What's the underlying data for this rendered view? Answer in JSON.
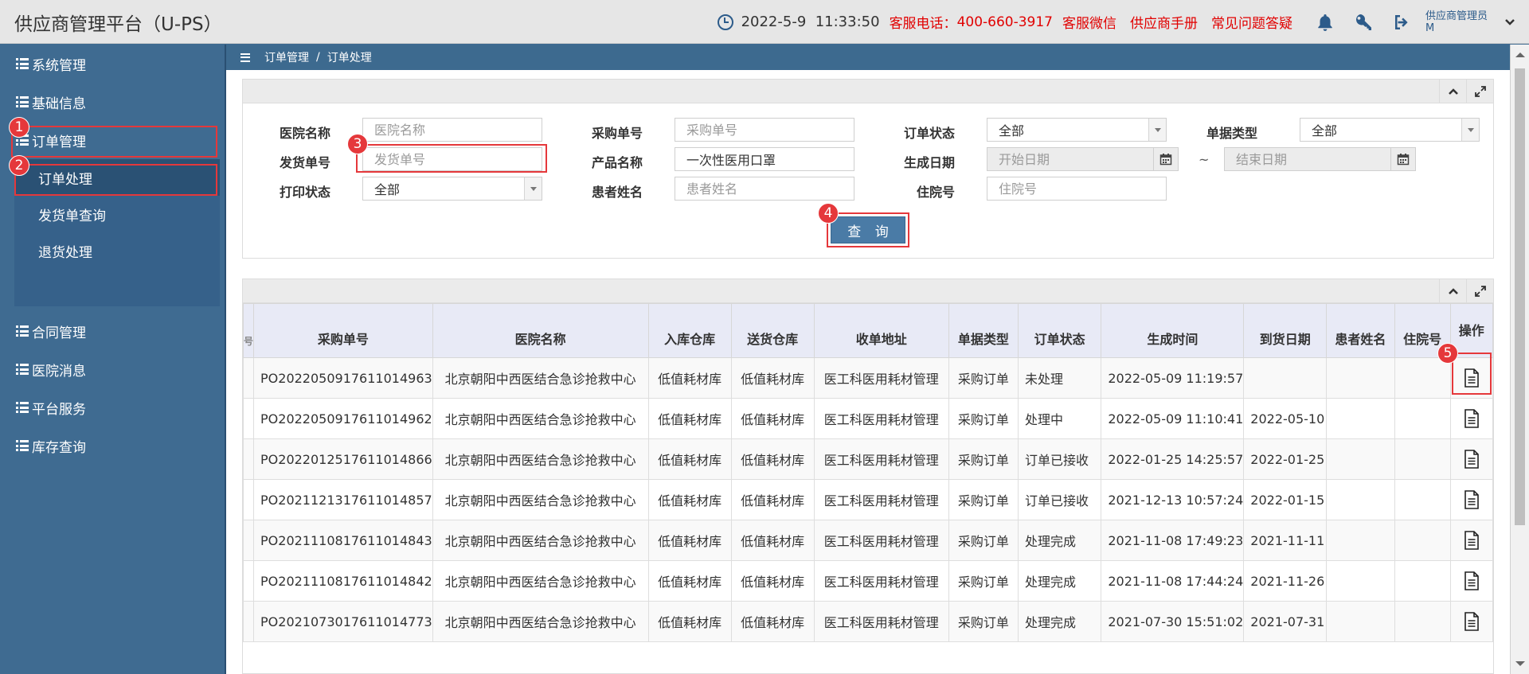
{
  "header": {
    "app_title": "供应商管理平台（U-PS）",
    "datetime": "2022-5-9  11:33:50",
    "hotline_label": "客服电话：",
    "hotline_number": "400-660-3917",
    "links": [
      "客服微信",
      "供应商手册",
      "常见问题答疑"
    ],
    "user_name_line1": "供应商管理员",
    "user_name_line2": "M"
  },
  "sidebar": {
    "items": [
      {
        "label": "系统管理"
      },
      {
        "label": "基础信息"
      },
      {
        "label": "订单管理"
      },
      {
        "label": "合同管理"
      },
      {
        "label": "医院消息"
      },
      {
        "label": "平台服务"
      },
      {
        "label": "库存查询"
      }
    ],
    "sub_items": [
      {
        "label": "订单处理"
      },
      {
        "label": "发货单查询"
      },
      {
        "label": "退货处理"
      }
    ]
  },
  "breadcrumb": {
    "parent": "订单管理",
    "separator": "/",
    "current": "订单处理"
  },
  "filters": {
    "hospital_label": "医院名称",
    "hospital_placeholder": "医院名称",
    "purchase_no_label": "采购单号",
    "purchase_no_placeholder": "采购单号",
    "order_status_label": "订单状态",
    "order_status_value": "全部",
    "doc_type_label": "单据类型",
    "doc_type_value": "全部",
    "ship_no_label": "发货单号",
    "ship_no_placeholder": "发货单号",
    "product_label": "产品名称",
    "product_value": "一次性医用口罩",
    "create_date_label": "生成日期",
    "start_date_placeholder": "开始日期",
    "range_sep": "~",
    "end_date_placeholder": "结束日期",
    "print_status_label": "打印状态",
    "print_status_value": "全部",
    "patient_label": "患者姓名",
    "patient_placeholder": "患者姓名",
    "inpatient_label": "住院号",
    "inpatient_placeholder": "住院号",
    "query_button": "查 询"
  },
  "annotations": [
    "1",
    "2",
    "3",
    "4",
    "5"
  ],
  "table": {
    "col_cut_mark": "号",
    "headers": [
      "采购单号",
      "医院名称",
      "入库仓库",
      "送货仓库",
      "收单地址",
      "单据类型",
      "订单状态",
      "生成时间",
      "到货日期",
      "患者姓名",
      "住院号",
      "操作"
    ],
    "rows": [
      {
        "po": "PO2022050917611014963",
        "hospital": "北京朝阳中西医结合急诊抢救中心",
        "in_wh": "低值耗材库",
        "out_wh": "低值耗材库",
        "addr": "医工科医用耗材管理",
        "type": "采购订单",
        "status": "未处理",
        "created": "2022-05-09 11:19:57",
        "arrival": "",
        "patient": "",
        "inpatient": ""
      },
      {
        "po": "PO2022050917611014962",
        "hospital": "北京朝阳中西医结合急诊抢救中心",
        "in_wh": "低值耗材库",
        "out_wh": "低值耗材库",
        "addr": "医工科医用耗材管理",
        "type": "采购订单",
        "status": "处理中",
        "created": "2022-05-09 11:10:41",
        "arrival": "2022-05-10",
        "patient": "",
        "inpatient": ""
      },
      {
        "po": "PO2022012517611014866",
        "hospital": "北京朝阳中西医结合急诊抢救中心",
        "in_wh": "低值耗材库",
        "out_wh": "低值耗材库",
        "addr": "医工科医用耗材管理",
        "type": "采购订单",
        "status": "订单已接收",
        "created": "2022-01-25 14:25:57",
        "arrival": "2022-01-25",
        "patient": "",
        "inpatient": ""
      },
      {
        "po": "PO2021121317611014857",
        "hospital": "北京朝阳中西医结合急诊抢救中心",
        "in_wh": "低值耗材库",
        "out_wh": "低值耗材库",
        "addr": "医工科医用耗材管理",
        "type": "采购订单",
        "status": "订单已接收",
        "created": "2021-12-13 10:57:24",
        "arrival": "2022-01-15",
        "patient": "",
        "inpatient": ""
      },
      {
        "po": "PO2021110817611014843",
        "hospital": "北京朝阳中西医结合急诊抢救中心",
        "in_wh": "低值耗材库",
        "out_wh": "低值耗材库",
        "addr": "医工科医用耗材管理",
        "type": "采购订单",
        "status": "处理完成",
        "created": "2021-11-08 17:49:23",
        "arrival": "2021-11-11",
        "patient": "",
        "inpatient": ""
      },
      {
        "po": "PO2021110817611014842",
        "hospital": "北京朝阳中西医结合急诊抢救中心",
        "in_wh": "低值耗材库",
        "out_wh": "低值耗材库",
        "addr": "医工科医用耗材管理",
        "type": "采购订单",
        "status": "处理完成",
        "created": "2021-11-08 17:44:24",
        "arrival": "2021-11-26",
        "patient": "",
        "inpatient": ""
      },
      {
        "po": "PO2021073017611014773",
        "hospital": "北京朝阳中西医结合急诊抢救中心",
        "in_wh": "低值耗材库",
        "out_wh": "低值耗材库",
        "addr": "医工科医用耗材管理",
        "type": "采购订单",
        "status": "处理完成",
        "created": "2021-07-30 15:51:02",
        "arrival": "2021-07-31",
        "patient": "",
        "inpatient": ""
      }
    ]
  },
  "colors": {
    "header_bg": "#e6e6e6",
    "sidebar_bg": "#3f6b91",
    "accent_red": "#e10000",
    "annotation_red": "#e5383b",
    "button_blue": "#4a7ba6"
  }
}
